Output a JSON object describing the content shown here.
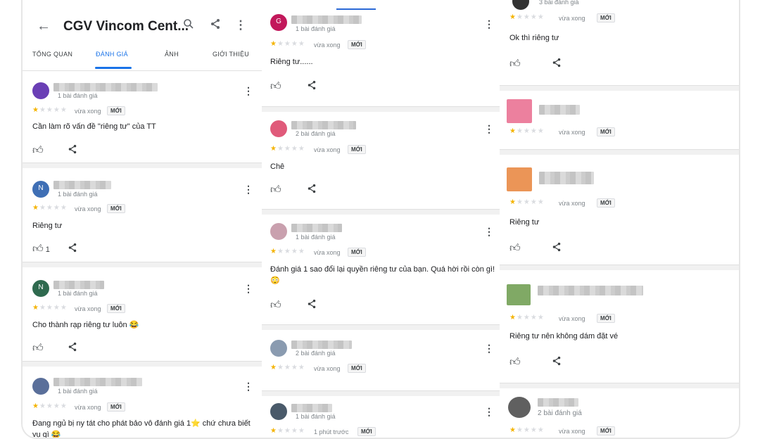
{
  "header": {
    "back_icon": "arrow-left-icon",
    "title": "CGV Vincom Cent...",
    "tabs": [
      "TỔNG QUAN",
      "ĐÁNH GIÁ",
      "ẢNH",
      "GIỚI THIỆU"
    ],
    "active_tab": "ĐÁNH GIÁ"
  },
  "labels": {
    "new_badge": "MỚI"
  },
  "colors": {
    "accent": "#1a73e8",
    "star": "#f4b400"
  },
  "columns": [
    {
      "reviews": [
        {
          "reviewer_count": "1 bài đánh giá",
          "avatar_letter": "",
          "avatar_color": "#6a3fb5",
          "rating": 1,
          "time": "vừa xong",
          "text": "Cần làm rõ vấn đề \"riêng tư\" của TT",
          "likes": ""
        },
        {
          "reviewer_count": "1 bài đánh giá",
          "avatar_letter": "N",
          "avatar_color": "#3f6fb5",
          "rating": 1,
          "time": "vừa xong",
          "text": "Riêng tư",
          "likes": "1"
        },
        {
          "reviewer_count": "1 bài đánh giá",
          "avatar_letter": "N",
          "avatar_color": "#2f6a4f",
          "rating": 1,
          "time": "vừa xong",
          "text": "Cho thành rạp riêng tư luôn 😂",
          "likes": ""
        },
        {
          "reviewer_count": "1 bài đánh giá",
          "avatar_letter": "",
          "avatar_color": "#5a6f9a",
          "rating": 1,
          "time": "vừa xong",
          "text": "Đang ngủ bị ny tát cho phát bảo vô đánh giá 1⭐ chứ chưa biết vụ gì 😂",
          "likes": ""
        }
      ]
    },
    {
      "reviews": [
        {
          "reviewer_count": "1 bài đánh giá",
          "avatar_letter": "G",
          "avatar_color": "#c2185b",
          "rating": 1,
          "time": "vừa xong",
          "text": "Riêng tư......",
          "likes": ""
        },
        {
          "reviewer_count": "2 bài đánh giá",
          "avatar_letter": "",
          "avatar_color": "#e05a7a",
          "rating": 1,
          "time": "vừa xong",
          "text": "Chê",
          "likes": ""
        },
        {
          "reviewer_count": "1 bài đánh giá",
          "avatar_letter": "",
          "avatar_color": "#c9a0ae",
          "rating": 1,
          "time": "vừa xong",
          "text": "Đánh giá 1 sao đổi lại quyền riêng tư của bạn. Quá hời rồi còn gì! 😳",
          "likes": ""
        },
        {
          "reviewer_count": "2 bài đánh giá",
          "avatar_letter": "",
          "avatar_color": "#8a9bb0",
          "rating": 1,
          "time": "vừa xong",
          "text": "",
          "likes": ""
        },
        {
          "reviewer_count": "1 bài đánh giá",
          "avatar_letter": "",
          "avatar_color": "#4a5a6a",
          "rating": 1,
          "time": "1 phút trước",
          "text": "",
          "likes": ""
        }
      ]
    },
    {
      "reviews": [
        {
          "reviewer_count": "3 bài đánh giá",
          "avatar_letter": "",
          "avatar_color": "#333333",
          "rating": 1,
          "time": "vừa xong",
          "text": "Ok thì riêng tư",
          "likes": ""
        },
        {
          "reviewer_count": "",
          "avatar_letter": "",
          "avatar_color": "#e96a8d",
          "rating": 1,
          "time": "vừa xong",
          "text": "",
          "likes": ""
        },
        {
          "reviewer_count": "",
          "avatar_letter": "",
          "avatar_color": "#e8823a",
          "rating": 1,
          "time": "vừa xong",
          "text": "Riêng tư",
          "likes": ""
        },
        {
          "reviewer_count": "",
          "avatar_letter": "",
          "avatar_color": "#6a9a4a",
          "rating": 1,
          "time": "vừa xong",
          "text": "Riêng tư nên không dám đặt vé",
          "likes": ""
        },
        {
          "reviewer_count": "2 bài đánh giá",
          "avatar_letter": "",
          "avatar_color": "#444444",
          "rating": 1,
          "time": "vừa xong",
          "text": "",
          "likes": ""
        }
      ]
    }
  ],
  "icons": {
    "search": "search-icon",
    "share": "share-icon",
    "more": "more-vert-icon",
    "like": "thumb-up-icon"
  }
}
